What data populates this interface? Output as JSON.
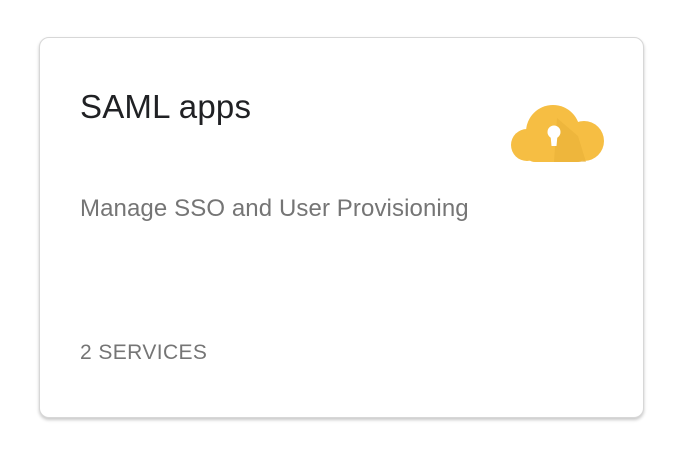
{
  "card": {
    "title": "SAML apps",
    "description": "Manage SSO and User Provisioning",
    "footer": "2 SERVICES",
    "icon": "cloud-keyhole-icon",
    "icon_color": "#F6BE43"
  }
}
